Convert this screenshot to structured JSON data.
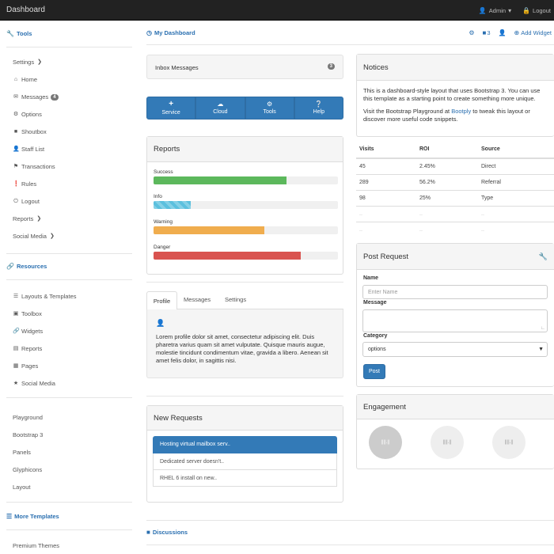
{
  "navbar": {
    "brand": "Dashboard",
    "admin": "Admin",
    "logout": "Logout"
  },
  "sidebar": {
    "tools_heading": "Tools",
    "tools": [
      {
        "label": "Settings",
        "icon": "chevron-down-icon"
      },
      {
        "label": "Home",
        "icon": "home-icon"
      },
      {
        "label": "Messages",
        "icon": "envelope-icon",
        "badge": "4"
      },
      {
        "label": "Options",
        "icon": "cog-icon"
      },
      {
        "label": "Shoutbox",
        "icon": "comment-icon"
      },
      {
        "label": "Staff List",
        "icon": "user-icon"
      },
      {
        "label": "Transactions",
        "icon": "flag-icon"
      },
      {
        "label": "Rules",
        "icon": "exclamation-icon"
      },
      {
        "label": "Logout",
        "icon": "power-icon"
      },
      {
        "label": "Reports",
        "icon": "chevron-right-icon"
      },
      {
        "label": "Social Media",
        "icon": "chevron-right-icon"
      }
    ],
    "resources_heading": "Resources",
    "resources": [
      {
        "label": "Layouts & Templates",
        "icon": "list-icon"
      },
      {
        "label": "Toolbox",
        "icon": "briefcase-icon"
      },
      {
        "label": "Widgets",
        "icon": "link-icon"
      },
      {
        "label": "Reports",
        "icon": "list-alt-icon"
      },
      {
        "label": "Pages",
        "icon": "book-icon"
      },
      {
        "label": "Social Media",
        "icon": "star-icon"
      }
    ],
    "links": [
      "Playground",
      "Bootstrap 3",
      "Panels",
      "Glyphicons",
      "Layout"
    ],
    "more_heading": "More Templates",
    "premium": "Premium Themes"
  },
  "main": {
    "heading": "My Dashboard",
    "add_widget": "Add Widget",
    "top_badge": "3",
    "inbox": {
      "label": "Inbox Messages",
      "count": "3"
    },
    "buttons": [
      "Service",
      "Cloud",
      "Tools",
      "Help"
    ],
    "reports": {
      "title": "Reports",
      "bars": [
        {
          "label": "Success",
          "value": 0.72,
          "color": "#5cb85c"
        },
        {
          "label": "Info",
          "value": 0.2,
          "color": "#5bc0de"
        },
        {
          "label": "Warning",
          "value": 0.6,
          "color": "#f0ad4e"
        },
        {
          "label": "Danger",
          "value": 0.8,
          "color": "#d9534f"
        }
      ]
    },
    "tabs": [
      "Profile",
      "Messages",
      "Settings"
    ],
    "profile_text": "Lorem profile dolor sit amet, consectetur adipiscing elit. Duis pharetra varius quam sit amet vulputate. Quisque mauris augue, molestie tincidunt condimentum vitae, gravida a libero. Aenean sit amet felis dolor, in sagittis nisi.",
    "requests": {
      "title": "New Requests",
      "items": [
        "Hosting virtual mailbox serv..",
        "Dedicated server doesn't..",
        "RHEL 6 install on new.."
      ]
    },
    "discussions": "Discussions"
  },
  "right": {
    "notices": {
      "title": "Notices",
      "p1": "This is a dashboard-style layout that uses Bootstrap 3. You can use this template as a starting point to create something more unique.",
      "p2_pre": "Visit the Bootstrap Playground at ",
      "p2_link": "Bootply",
      "p2_post": " to tweak this layout or discover more useful code snippets."
    },
    "table": {
      "headers": [
        "Visits",
        "ROI",
        "Source"
      ],
      "rows": [
        [
          "45",
          "2.45%",
          "Direct"
        ],
        [
          "289",
          "56.2%",
          "Referral"
        ],
        [
          "98",
          "25%",
          "Type"
        ],
        [
          "..",
          "..",
          ".."
        ],
        [
          "..",
          "..",
          ".."
        ]
      ]
    },
    "post": {
      "title": "Post Request",
      "name_label": "Name",
      "name_placeholder": "Enter Name",
      "message_label": "Message",
      "category_label": "Category",
      "category_value": "options",
      "submit": "Post"
    },
    "engagement": {
      "title": "Engagement",
      "circles": [
        "||||.||",
        "||||.||",
        "||||.||"
      ]
    }
  },
  "colors": {
    "primary": "#337ab7",
    "link": "#2a6fb0",
    "navbar": "#222222"
  }
}
